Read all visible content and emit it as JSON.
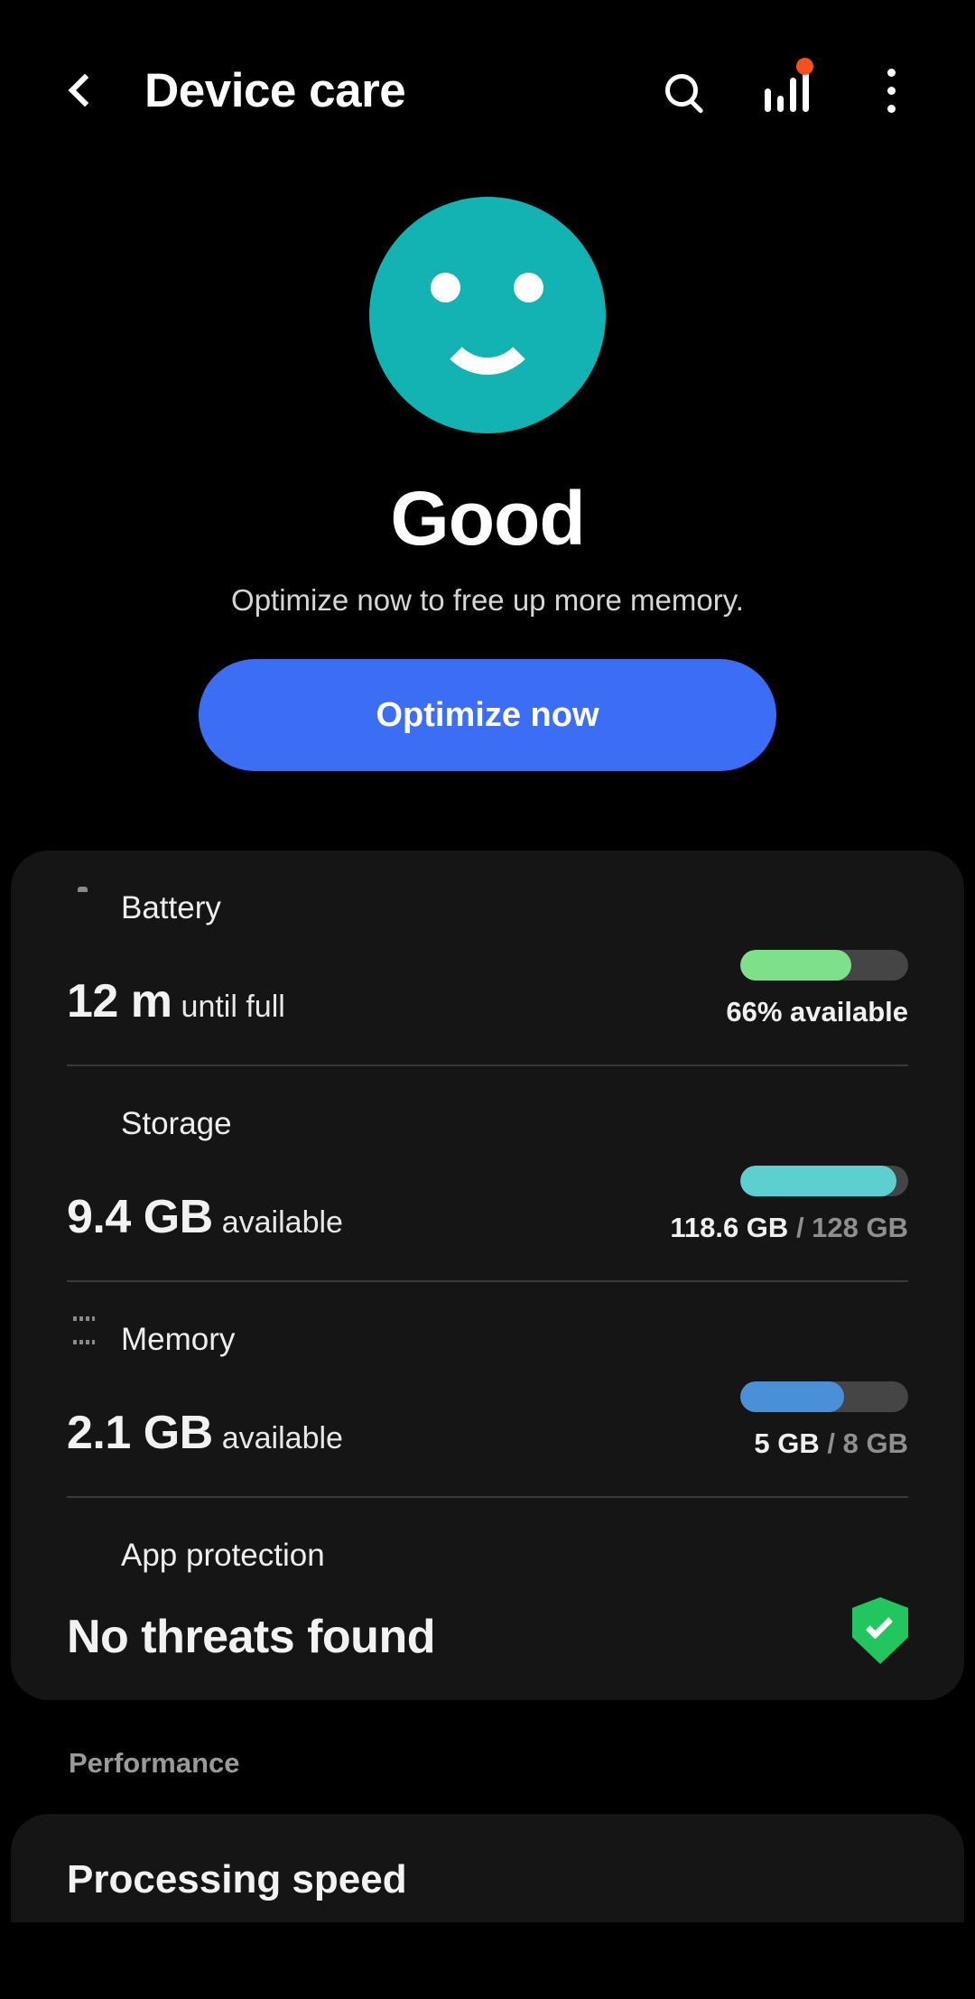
{
  "header": {
    "back_icon": "chevron-left-icon",
    "title": "Device care",
    "search_icon": "search-icon",
    "stats_icon": "bar-chart-icon",
    "stats_badge": true,
    "more_icon": "more-vertical-icon"
  },
  "hero": {
    "face_icon": "smiley-face-icon",
    "face_color": "#13b3b3",
    "status": "Good",
    "subtitle": "Optimize now to free up more memory.",
    "button_label": "Optimize now",
    "button_color": "#3b6ef5"
  },
  "status_card": {
    "rows": [
      {
        "icon": "battery-icon",
        "label": "Battery",
        "value": "12 m",
        "unit": "until full",
        "percent": 66,
        "bar_color": "#7fe08a",
        "caption": "66% available",
        "caption_muted": ""
      },
      {
        "icon": "storage-pie-icon",
        "label": "Storage",
        "value": "9.4 GB",
        "unit": "available",
        "percent": 93,
        "bar_color": "#5cd0cf",
        "caption": "118.6 GB",
        "caption_muted": "/ 128 GB"
      },
      {
        "icon": "memory-chip-icon",
        "label": "Memory",
        "value": "2.1 GB",
        "unit": "available",
        "percent": 62,
        "bar_color": "#4a90d9",
        "caption": "5 GB",
        "caption_muted": "/ 8 GB"
      }
    ],
    "protection": {
      "icon": "shield-icon",
      "label": "App protection",
      "value": "No threats found",
      "status_icon": "shield-check-icon",
      "status_color": "#22c55e"
    }
  },
  "performance": {
    "section_label": "Performance",
    "first_item": "Processing speed"
  }
}
